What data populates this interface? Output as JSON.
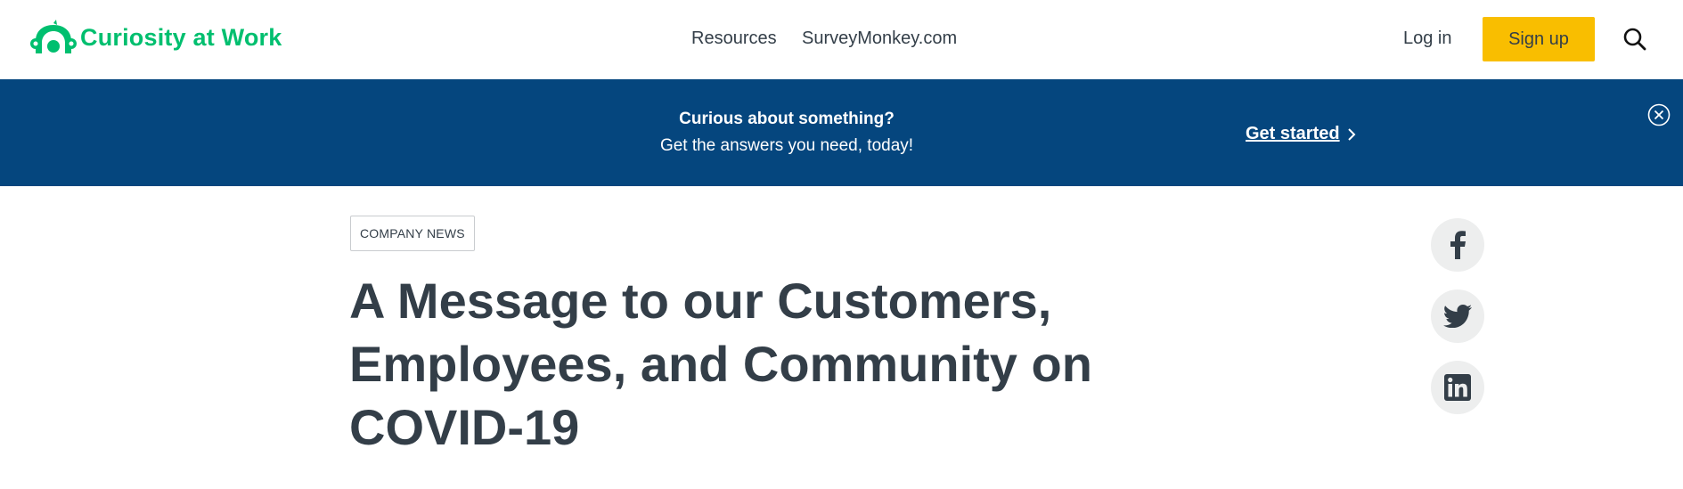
{
  "header": {
    "logo_text": "Curiosity at Work",
    "nav": [
      {
        "label": "Resources"
      },
      {
        "label": "SurveyMonkey.com"
      }
    ],
    "login_label": "Log in",
    "signup_label": "Sign up",
    "search_icon": "search-icon"
  },
  "banner": {
    "title": "Curious about something?",
    "subtitle": "Get the answers you need, today!",
    "cta_label": "Get started",
    "close_icon": "close-circle-icon"
  },
  "article": {
    "tag": "COMPANY NEWS",
    "title": "A Message to our Customers, Employees, and Community on COVID-19"
  },
  "share": [
    {
      "icon": "facebook-icon"
    },
    {
      "icon": "twitter-icon"
    },
    {
      "icon": "linkedin-icon"
    }
  ],
  "colors": {
    "brand_green": "#00bf6f",
    "banner_blue": "#05467e",
    "signup_yellow": "#f9be00",
    "text_dark": "#333e48",
    "share_bg": "#edeeee"
  }
}
